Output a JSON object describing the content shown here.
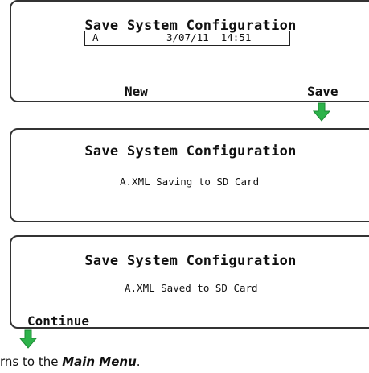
{
  "screen1": {
    "title": "Save System Configuration",
    "filename": "A",
    "datetime": "3/07/11  14:51",
    "softkey_left": "New",
    "softkey_right": "Save"
  },
  "screen2": {
    "title": "Save System Configuration",
    "message": "A.XML Saving to SD Card"
  },
  "screen3": {
    "title": "Save System Configuration",
    "message": "A.XML Saved to SD Card",
    "softkey_left": "Continue"
  },
  "footer": {
    "text_prefix": "rns to the ",
    "emphasis": "Main Menu",
    "suffix": "."
  },
  "colors": {
    "arrow": "#2db34a",
    "border": "#333333"
  },
  "icons": {
    "arrow": "arrow-down-icon"
  }
}
